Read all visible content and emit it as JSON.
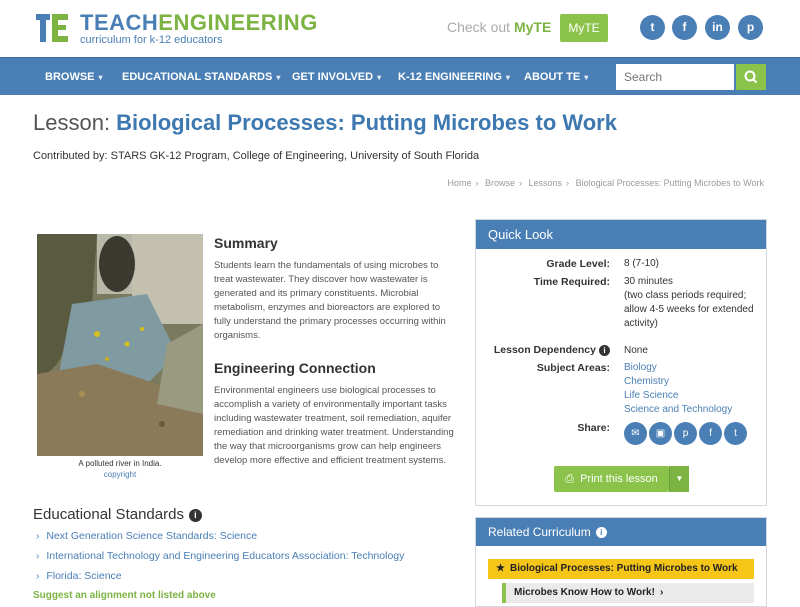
{
  "brand": {
    "teach": "TEACH",
    "eng": "ENGINEERING",
    "tagline": "curriculum for k-12 educators"
  },
  "myte": {
    "prefix": "Check out ",
    "name": "MyTE",
    "button": "MyTE"
  },
  "social": [
    {
      "icon": "twitter-icon",
      "glyph": "t"
    },
    {
      "icon": "facebook-icon",
      "glyph": "f"
    },
    {
      "icon": "linkedin-icon",
      "glyph": "in"
    },
    {
      "icon": "pinterest-icon",
      "glyph": "p"
    }
  ],
  "nav": {
    "items": [
      "BROWSE",
      "EDUCATIONAL STANDARDS",
      "GET INVOLVED",
      "K-12 ENGINEERING",
      "ABOUT TE"
    ],
    "search_placeholder": "Search"
  },
  "lesson": {
    "prefix": "Lesson: ",
    "title": "Biological Processes: Putting Microbes to Work",
    "contributed": "Contributed by: STARS GK-12 Program, College of Engineering, University of South Florida"
  },
  "breadcrumb": [
    "Home",
    "Browse",
    "Lessons",
    "Biological Processes: Putting Microbes to Work"
  ],
  "photo": {
    "caption": "A polluted river in India.",
    "credit": "copyright"
  },
  "summary": {
    "heading": "Summary",
    "text": "Students learn the fundamentals of using microbes to treat wastewater. They discover how wastewater is generated and its primary constituents. Microbial metabolism, enzymes and bioreactors are explored to fully understand the primary processes occurring within organisms."
  },
  "engineering": {
    "heading": "Engineering Connection",
    "text": "Environmental engineers use biological processes to accomplish a variety of environmentally important tasks including wastewater treatment, soil remediation, aquifer remediation and drinking water treatment. Understanding the way that microorganisms grow can help engineers develop more effective and efficient treatment systems."
  },
  "standards": {
    "heading": "Educational Standards",
    "links": [
      "Next Generation Science Standards: Science",
      "International Technology and Engineering Educators Association: Technology",
      "Florida: Science"
    ],
    "suggest": "Suggest an alignment not listed above"
  },
  "quicklook": {
    "heading": "Quick Look",
    "grade_label": "Grade Level:",
    "grade": "8 (7-10)",
    "time_label": "Time Required:",
    "time": "30 minutes",
    "time_note": "(two class periods required; allow 4-5 weeks for extended activity)",
    "dependency_label": "Lesson Dependency",
    "dependency": "None",
    "subjects_label": "Subject Areas:",
    "subjects": [
      "Biology",
      "Chemistry",
      "Life Science",
      "Science and Technology"
    ],
    "share_label": "Share:",
    "print": "Print this lesson"
  },
  "related": {
    "heading": "Related Curriculum",
    "items": [
      "Biological Processes: Putting Microbes to Work",
      "Microbes Know How to Work!"
    ]
  }
}
